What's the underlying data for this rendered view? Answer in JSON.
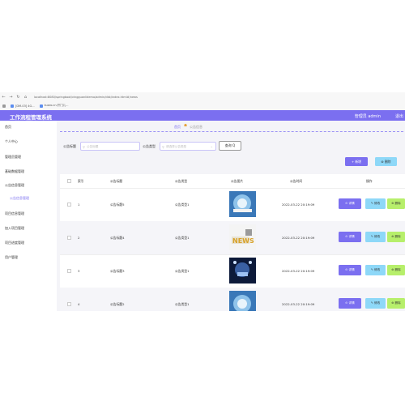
{
  "browser": {
    "url": "localhost:8080/springboot/vingguanlidemo/admin/dist/index.html#/news",
    "bookmarks": [
      "[DM-03] 4G...",
      "kuaro.cn.开门儿..."
    ]
  },
  "header": {
    "title": "工作流程管理系统",
    "admin": "管理员 admin",
    "logout": "退出"
  },
  "sidebar": {
    "items": [
      "首页",
      "个人中心",
      "管理员管理",
      "基础数据管理",
      "公告信息管理",
      "公告信息管理",
      "项目信息管理",
      "加入项目管理",
      "项目进度管理",
      "用户管理"
    ]
  },
  "breadcrumb": {
    "home": "首页",
    "current": "公告信息"
  },
  "search": {
    "title_label": "公告标题",
    "title_placeholder": "公告标题",
    "type_label": "公告类型",
    "type_placeholder": "请选择公告类型",
    "query_btn": "查询 Q"
  },
  "actions": {
    "add": "+ 新增",
    "delete": "⊗ 删除"
  },
  "table": {
    "columns": [
      "索引",
      "公告标题",
      "公告类型",
      "公告图片",
      "公告时间",
      "操作"
    ],
    "rows": [
      {
        "index": "1",
        "title": "公告标题5",
        "type": "公告类型1",
        "time": "2022-03-22 20:19:09"
      },
      {
        "index": "2",
        "title": "公告标题4",
        "type": "公告类型1",
        "time": "2022-03-22 20:19:09"
      },
      {
        "index": "3",
        "title": "公告标题3",
        "type": "公告类型1",
        "time": "2022-03-22 20:19:09"
      },
      {
        "index": "4",
        "title": "公告标题2",
        "type": "公告类型1",
        "time": "2022-03-22 20:19:09"
      }
    ],
    "row_actions": {
      "detail": "⊙ 详情",
      "edit": "✎ 修改",
      "delete": "⊗ 删除"
    }
  },
  "colors": {
    "primary": "#7b6ff0",
    "edit": "#8ed8f8",
    "delete": "#b7ef6b"
  }
}
